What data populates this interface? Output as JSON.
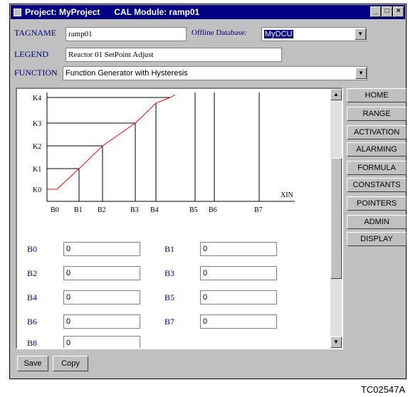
{
  "window": {
    "title": "Project: MyProject      CAL Module: ramp01",
    "controls": [
      "minimize-icon",
      "restore-icon",
      "close-icon"
    ]
  },
  "form": {
    "tagname_label": "TAGNAME",
    "tagname_value": "ramp01",
    "offline_db_label": "Offline Database:",
    "offline_db_value": "MyDCU",
    "legend_label": "LEGEND",
    "legend_value": "Reactor 01 SetPoint Adjust",
    "function_label": "FUNCTION",
    "function_value": "Function Generator with Hysteresis"
  },
  "graph": {
    "y_labels": [
      "K4",
      "K3",
      "K2",
      "K1",
      "K0"
    ],
    "x_labels": [
      "B0",
      "B1",
      "B2",
      "B3",
      "B4",
      "B5",
      "B6",
      "B7"
    ],
    "axis_label": "XIN",
    "line_color": "#ff0000"
  },
  "params": [
    {
      "label": "B0",
      "value": "0"
    },
    {
      "label": "B1",
      "value": "0"
    },
    {
      "label": "B2",
      "value": "0"
    },
    {
      "label": "B3",
      "value": "0"
    },
    {
      "label": "B4",
      "value": "0"
    },
    {
      "label": "B5",
      "value": "0"
    },
    {
      "label": "B6",
      "value": "0"
    },
    {
      "label": "B7",
      "value": "0"
    },
    {
      "label": "B8",
      "value": "0"
    }
  ],
  "nav": [
    "HOME",
    "RANGE",
    "ACTIVATION",
    "ALARMING",
    "FORMULA",
    "CONSTANTS",
    "POINTERS",
    "ADMIN",
    "DISPLAY"
  ],
  "buttons": {
    "save": "Save",
    "copy": "Copy"
  },
  "caption": "TC02547A"
}
